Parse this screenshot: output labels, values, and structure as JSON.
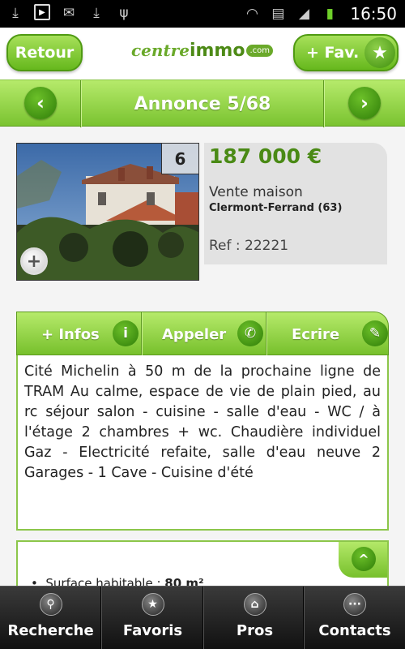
{
  "status_bar": {
    "time": "16:50",
    "icons": [
      "download-icon",
      "video-icon",
      "mail-icon",
      "download-icon",
      "usb-icon",
      "wifi-icon",
      "sim-icon",
      "signal-icon",
      "battery-icon"
    ]
  },
  "header": {
    "back_label": "Retour",
    "fav_label": "+ Fav.",
    "logo": {
      "part1": "centre",
      "part2": "immo",
      "part3": ".com"
    }
  },
  "nav": {
    "title": "Annonce 5/68"
  },
  "listing": {
    "photo_count": "6",
    "price": "187 000 €",
    "type": "Vente maison",
    "city": "Clermont-Ferrand (63)",
    "ref": "Ref : 22221"
  },
  "actions": {
    "infos_label": "+ Infos",
    "call_label": "Appeler",
    "write_label": "Ecrire"
  },
  "description": "Cité Michelin à 50 m de la prochaine ligne de TRAM Au calme, espace de vie de plain pied, au rc séjour salon - cuisine - salle d'eau - WC / à l'étage 2 chambres + wc. Chaudière individuel Gaz - Electricité refaite, salle d'eau neuve 2 Garages - 1 Cave - Cuisine d'été",
  "features": {
    "surface_label": "Surface habitable :",
    "surface_value": "80 m²"
  },
  "bottom_nav": {
    "search": "Recherche",
    "favorites": "Favoris",
    "pros": "Pros",
    "contacts": "Contacts"
  },
  "colors": {
    "accent": "#77c02c",
    "price": "#4a8a15",
    "bottom_bar": "#1a1a1a"
  }
}
